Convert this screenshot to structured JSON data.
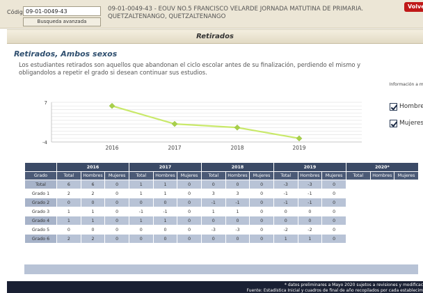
{
  "search": {
    "codigo_label": "Código",
    "codigo_value": "09-01-0049-43",
    "busqueda_label": "Busqueda avanzada"
  },
  "school": {
    "line1": "09-01-0049-43 - EOUV NO.5 FRANCISCO VELARDE JORNADA MATUTINA DE PRIMARIA.",
    "line2": "QUETZALTENANGO, QUETZALTENANGO"
  },
  "header": {
    "title": "Retirados",
    "volver_label": "Volve"
  },
  "page": {
    "title": "Retirados, Ambos sexos",
    "description": "Los estudiantes retirados son aquellos que abandonan el ciclo escolar antes de su finalización, perdiendo el mismo y obligandolos a repetir el grado si desean continuar sus estudios."
  },
  "options": {
    "info_label": "Información a mostrar",
    "hombres_label": "Hombre",
    "mujeres_label": "Mujeres",
    "hombres_checked": true,
    "mujeres_checked": true
  },
  "chart_data": {
    "type": "line",
    "title": "",
    "xlabel": "",
    "ylabel": "",
    "categories": [
      "2016",
      "2017",
      "2018",
      "2019"
    ],
    "series": [
      {
        "values": [
          6,
          1,
          0,
          -3
        ]
      }
    ],
    "ylim": [
      -4,
      7
    ],
    "y_tick_labels": [
      "7",
      "-4"
    ],
    "grid": true,
    "line_color": "#c9e96a",
    "marker_color": "#a8d04a"
  },
  "table": {
    "grado_header": "Grado",
    "years": [
      "2016",
      "2017",
      "2018",
      "2019",
      "2020*"
    ],
    "sub_headers": [
      "Total",
      "Hombres",
      "Mujeres"
    ],
    "rows": [
      {
        "grado": "Total",
        "values": [
          "6",
          "6",
          "0",
          "1",
          "1",
          "0",
          "0",
          "0",
          "0",
          "-3",
          "-3",
          "0",
          "",
          "",
          ""
        ]
      },
      {
        "grado": "Grado 1",
        "values": [
          "2",
          "2",
          "0",
          "1",
          "1",
          "0",
          "3",
          "3",
          "0",
          "-1",
          "-1",
          "0",
          "",
          "",
          ""
        ]
      },
      {
        "grado": "Grado 2",
        "values": [
          "0",
          "0",
          "0",
          "0",
          "0",
          "0",
          "-1",
          "-1",
          "0",
          "-1",
          "-1",
          "0",
          "",
          "",
          ""
        ]
      },
      {
        "grado": "Grado 3",
        "values": [
          "1",
          "1",
          "0",
          "-1",
          "-1",
          "0",
          "1",
          "1",
          "0",
          "0",
          "0",
          "0",
          "",
          "",
          ""
        ]
      },
      {
        "grado": "Grado 4",
        "values": [
          "1",
          "1",
          "0",
          "1",
          "1",
          "0",
          "0",
          "0",
          "0",
          "0",
          "0",
          "0",
          "",
          "",
          ""
        ]
      },
      {
        "grado": "Grado 5",
        "values": [
          "0",
          "0",
          "0",
          "0",
          "0",
          "0",
          "-3",
          "-3",
          "0",
          "-2",
          "-2",
          "0",
          "",
          "",
          ""
        ]
      },
      {
        "grado": "Grado 6",
        "values": [
          "2",
          "2",
          "0",
          "0",
          "0",
          "0",
          "0",
          "0",
          "0",
          "1",
          "1",
          "0",
          "",
          "",
          ""
        ]
      }
    ]
  },
  "footer": {
    "note1": "* datos preliminares a Mayo 2020 sujetos a revisiones y modificac",
    "note2": "Fuente: Estadística Inicial y cuadros de final de año recopilados por cada establecim"
  }
}
